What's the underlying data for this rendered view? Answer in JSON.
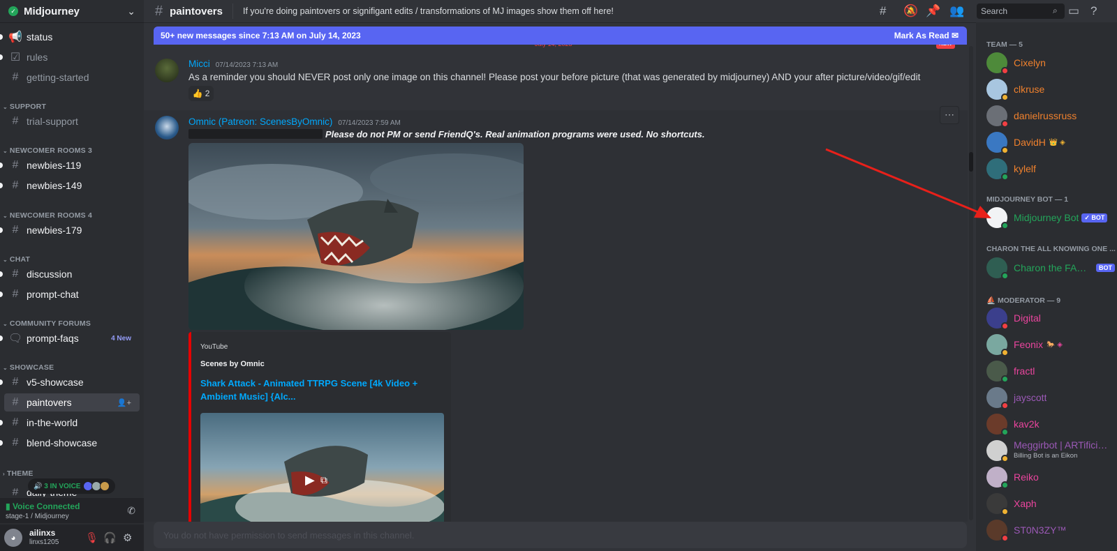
{
  "server": {
    "name": "Midjourney"
  },
  "sidebar": {
    "channels": [
      {
        "label": "status",
        "icon": "megaphone-icon"
      },
      {
        "label": "rules",
        "icon": "checkbox-icon"
      },
      {
        "label": "getting-started",
        "icon": "hash-icon"
      },
      {
        "label": "trial-support",
        "icon": "hash-icon"
      },
      {
        "label": "newbies-119",
        "icon": "hash-thread-icon"
      },
      {
        "label": "newbies-149",
        "icon": "hash-thread-icon"
      },
      {
        "label": "newbies-179",
        "icon": "hash-thread-icon"
      },
      {
        "label": "discussion",
        "icon": "hash-thread-icon"
      },
      {
        "label": "prompt-chat",
        "icon": "hash-thread-icon"
      },
      {
        "label": "prompt-faqs",
        "icon": "forum-icon",
        "badge": "4 New"
      },
      {
        "label": "v5-showcase",
        "icon": "hash-icon"
      },
      {
        "label": "paintovers",
        "icon": "hash-icon"
      },
      {
        "label": "in-the-world",
        "icon": "hash-icon"
      },
      {
        "label": "blend-showcase",
        "icon": "hash-icon"
      },
      {
        "label": "daily-theme",
        "icon": "hash-icon"
      }
    ],
    "categories": [
      "SUPPORT",
      "NEWCOMER ROOMS 3",
      "NEWCOMER ROOMS 4",
      "CHAT",
      "COMMUNITY FORUMS",
      "SHOWCASE",
      "THEME"
    ],
    "voice_pill": "3 IN VOICE",
    "voice": {
      "status": "Voice Connected",
      "location": "stage-1 / Midjourney"
    },
    "user": {
      "name": "ailinxs",
      "tag": "linxs1205"
    }
  },
  "header": {
    "channel": "paintovers",
    "topic": "If you're doing paintovers or signifigant edits / transformations of MJ images show them off here!",
    "search_placeholder": "Search"
  },
  "banner": {
    "text": "50+ new messages since 7:13 AM on July 14, 2023",
    "action": "Mark As Read",
    "new_pill": "NEW",
    "date_separator": "July 14, 2023"
  },
  "messages": [
    {
      "author": "Micci",
      "author_color": "#00a8fc",
      "timestamp": "07/14/2023 7:13 AM",
      "text": "As a reminder you should NEVER post only one image on this channel! Please post your before picture (that was generated by midjourney) AND your after picture/video/gif/edit",
      "reaction": {
        "emoji": "👍",
        "count": "2"
      }
    },
    {
      "author": "Omnic (Patreon: ScenesByOmnic)",
      "author_color": "#00a8fc",
      "timestamp": "07/14/2023 7:59 AM",
      "text": "Please do not PM or send FriendQ's. Real animation programs were used. No shortcuts.",
      "embed": {
        "provider": "YouTube",
        "author": "Scenes by Omnic",
        "title": "Shark Attack - Animated TTRPG Scene [4k Video + Ambient Music] {Alc..."
      }
    }
  ],
  "composer": {
    "placeholder": "You do not have permission to send messages in this channel."
  },
  "members": {
    "roles": [
      "TEAM — 5",
      "MIDJOURNEY BOT — 1",
      "CHARON THE ALL KNOWING ONE ...",
      "MODERATOR — 9"
    ],
    "list": [
      {
        "name": "Cixelyn",
        "color": "#f0812d",
        "status": "#f23f43",
        "av": "#4e8a3a"
      },
      {
        "name": "clkruse",
        "color": "#f0812d",
        "status": "#f0b232",
        "av": "#a8c6e0"
      },
      {
        "name": "danielrussruss",
        "color": "#f0812d",
        "status": "#f23f43",
        "av": "#6b6f76"
      },
      {
        "name": "DavidH",
        "color": "#f0812d",
        "status": "#f0b232",
        "av": "#3a78c2",
        "icons": "👑 ◈"
      },
      {
        "name": "kylelf",
        "color": "#f0812d",
        "status": "#23a55a",
        "av": "#2f6e7a"
      },
      {
        "name": "Midjourney Bot",
        "color": "#23a55a",
        "status": "#23a55a",
        "av": "#f2f3f5",
        "badge": "✓ BOT"
      },
      {
        "name": "Charon the FAQ ...",
        "color": "#23a55a",
        "status": "#23a55a",
        "av": "#2f5e52",
        "badge": "BOT"
      },
      {
        "name": "Digital",
        "color": "#eb459e",
        "status": "#f23f43",
        "av": "#3b3f8c"
      },
      {
        "name": "Feonix",
        "color": "#eb459e",
        "status": "#f0b232",
        "av": "#7aa8a0",
        "icons": "🐎 ◈"
      },
      {
        "name": "fractl",
        "color": "#eb459e",
        "status": "#23a55a",
        "av": "#4a5a4a"
      },
      {
        "name": "jayscott",
        "color": "#9b59b6",
        "status": "#f23f43",
        "av": "#6a7a8a"
      },
      {
        "name": "kav2k",
        "color": "#eb459e",
        "status": "#23a55a",
        "av": "#6b3b2a"
      },
      {
        "name": "Meggirbot | ARTificial...",
        "color": "#9b59b6",
        "status": "#f0b232",
        "av": "#d0d0d0",
        "sub": "Billing Bot is an Eikon"
      },
      {
        "name": "Reiko",
        "color": "#eb459e",
        "status": "#23a55a",
        "av": "#c0b0c8"
      },
      {
        "name": "Xaph",
        "color": "#eb459e",
        "status": "#f0b232",
        "av": "#3a3a3a"
      },
      {
        "name": "ST0N3ZY™",
        "color": "#9b59b6",
        "status": "#f23f43",
        "av": "#5a3a2a"
      }
    ]
  }
}
